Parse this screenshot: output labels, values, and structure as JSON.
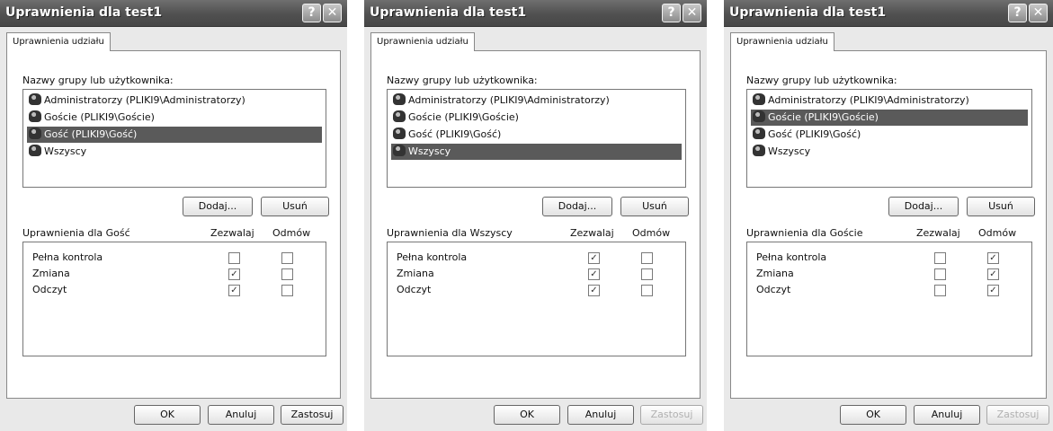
{
  "dialogs": [
    {
      "title": "Uprawnienia dla test1",
      "help_glyph": "?",
      "close_glyph": "✕",
      "tab": "Uprawnienia udziału",
      "groups_label": "Nazwy grupy lub użytkownika:",
      "users": [
        {
          "text": "Administratorzy (PLIKI9\\Administratorzy)",
          "selected": false
        },
        {
          "text": "Goście (PLIKI9\\Goście)",
          "selected": false
        },
        {
          "text": "Gość (PLIKI9\\Gość)",
          "selected": true
        },
        {
          "text": "Wszyscy",
          "selected": false
        }
      ],
      "add_label": "Dodaj...",
      "remove_label": "Usuń",
      "permissions_for": "Uprawnienia dla Gość",
      "allow_header": "Zezwalaj",
      "deny_header": "Odmów",
      "permissions": [
        {
          "name": "Pełna kontrola",
          "allow": false,
          "deny": false
        },
        {
          "name": "Zmiana",
          "allow": true,
          "deny": false
        },
        {
          "name": "Odczyt",
          "allow": true,
          "deny": false
        }
      ],
      "ok_label": "OK",
      "cancel_label": "Anuluj",
      "apply_label": "Zastosuj",
      "apply_enabled": true
    },
    {
      "title": "Uprawnienia dla test1",
      "help_glyph": "?",
      "close_glyph": "✕",
      "tab": "Uprawnienia udziału",
      "groups_label": "Nazwy grupy lub użytkownika:",
      "users": [
        {
          "text": "Administratorzy (PLIKI9\\Administratorzy)",
          "selected": false
        },
        {
          "text": "Goście (PLIKI9\\Goście)",
          "selected": false
        },
        {
          "text": "Gość (PLIKI9\\Gość)",
          "selected": false
        },
        {
          "text": "Wszyscy",
          "selected": true
        }
      ],
      "add_label": "Dodaj...",
      "remove_label": "Usuń",
      "permissions_for": "Uprawnienia dla Wszyscy",
      "allow_header": "Zezwalaj",
      "deny_header": "Odmów",
      "permissions": [
        {
          "name": "Pełna kontrola",
          "allow": true,
          "deny": false
        },
        {
          "name": "Zmiana",
          "allow": true,
          "deny": false
        },
        {
          "name": "Odczyt",
          "allow": true,
          "deny": false
        }
      ],
      "ok_label": "OK",
      "cancel_label": "Anuluj",
      "apply_label": "Zastosuj",
      "apply_enabled": false
    },
    {
      "title": "Uprawnienia dla test1",
      "help_glyph": "?",
      "close_glyph": "✕",
      "tab": "Uprawnienia udziału",
      "groups_label": "Nazwy grupy lub użytkownika:",
      "users": [
        {
          "text": "Administratorzy (PLIKI9\\Administratorzy)",
          "selected": false
        },
        {
          "text": "Goście (PLIKI9\\Goście)",
          "selected": true
        },
        {
          "text": "Gość (PLIKI9\\Gość)",
          "selected": false
        },
        {
          "text": "Wszyscy",
          "selected": false
        }
      ],
      "add_label": "Dodaj...",
      "remove_label": "Usuń",
      "permissions_for": "Uprawnienia dla Goście",
      "allow_header": "Zezwalaj",
      "deny_header": "Odmów",
      "permissions": [
        {
          "name": "Pełna kontrola",
          "allow": false,
          "deny": true
        },
        {
          "name": "Zmiana",
          "allow": false,
          "deny": true
        },
        {
          "name": "Odczyt",
          "allow": false,
          "deny": true
        }
      ],
      "ok_label": "OK",
      "cancel_label": "Anuluj",
      "apply_label": "Zastosuj",
      "apply_enabled": false
    }
  ]
}
